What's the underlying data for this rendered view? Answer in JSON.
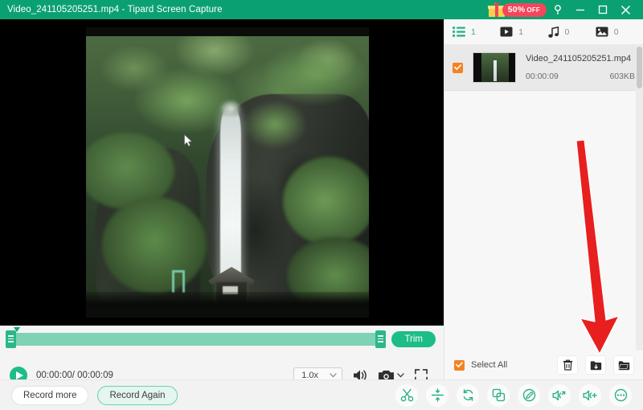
{
  "titlebar": {
    "file_name": "Video_241105205251.mp4",
    "separator": "-",
    "app_name": "Tipard Screen Capture",
    "title_full": "Video_241105205251.mp4  -  Tipard Screen Capture",
    "promo_number": "50%",
    "promo_off": "OFF",
    "gift_icon": "gift-icon",
    "help_icon": "help-question-icon",
    "minimize_icon": "minimize-icon",
    "maximize_icon": "maximize-icon",
    "close_icon": "close-icon",
    "bg_color": "#0ba072",
    "promo_color": "#f4465b"
  },
  "player": {
    "trim_button_label": "Trim",
    "play_icon": "play-icon",
    "current_time": "00:00:00",
    "total_time": "00:00:09",
    "time_display": "00:00:00/ 00:00:09",
    "speed_value": "1.0x",
    "speed_caret_icon": "chevron-down-icon",
    "volume_icon": "volume-icon",
    "snapshot_icon": "camera-icon",
    "snapshot_caret_icon": "chevron-down-icon",
    "fullscreen_icon": "fullscreen-icon",
    "cursor_icon": "mouse-cursor-icon"
  },
  "bottombar": {
    "record_more_label": "Record more",
    "record_again_label": "Record Again",
    "tools": [
      {
        "name": "trim-scissors-icon",
        "label": "Trim"
      },
      {
        "name": "split-icon",
        "label": "Split"
      },
      {
        "name": "rotate-icon",
        "label": "Rotate"
      },
      {
        "name": "merge-icon",
        "label": "Merge"
      },
      {
        "name": "edit-effect-icon",
        "label": "Edit"
      },
      {
        "name": "audio-export-icon",
        "label": "Audio"
      },
      {
        "name": "volume-boost-icon",
        "label": "Volume"
      },
      {
        "name": "more-options-icon",
        "label": "More"
      }
    ],
    "accent_color": "#2cb187"
  },
  "right_panel": {
    "tabs": [
      {
        "icon": "list-icon",
        "count": "1",
        "active": true
      },
      {
        "icon": "video-icon",
        "count": "1",
        "active": false
      },
      {
        "icon": "music-icon",
        "count": "0",
        "active": false
      },
      {
        "icon": "image-icon",
        "count": "0",
        "active": false
      }
    ],
    "files": [
      {
        "checked": true,
        "name": "Video_241105205251.mp4",
        "duration": "00:00:09",
        "size": "603KB"
      }
    ],
    "select_all_label": "Select All",
    "select_all_checked": true,
    "actions": [
      {
        "name": "delete-icon",
        "label": "Delete"
      },
      {
        "name": "share-export-icon",
        "label": "Share"
      },
      {
        "name": "open-folder-icon",
        "label": "Open folder"
      }
    ],
    "checkbox_color": "#f58220"
  },
  "annotation": {
    "arrow_color": "#e81f1f",
    "arrow_points_to": "share-export-icon"
  }
}
